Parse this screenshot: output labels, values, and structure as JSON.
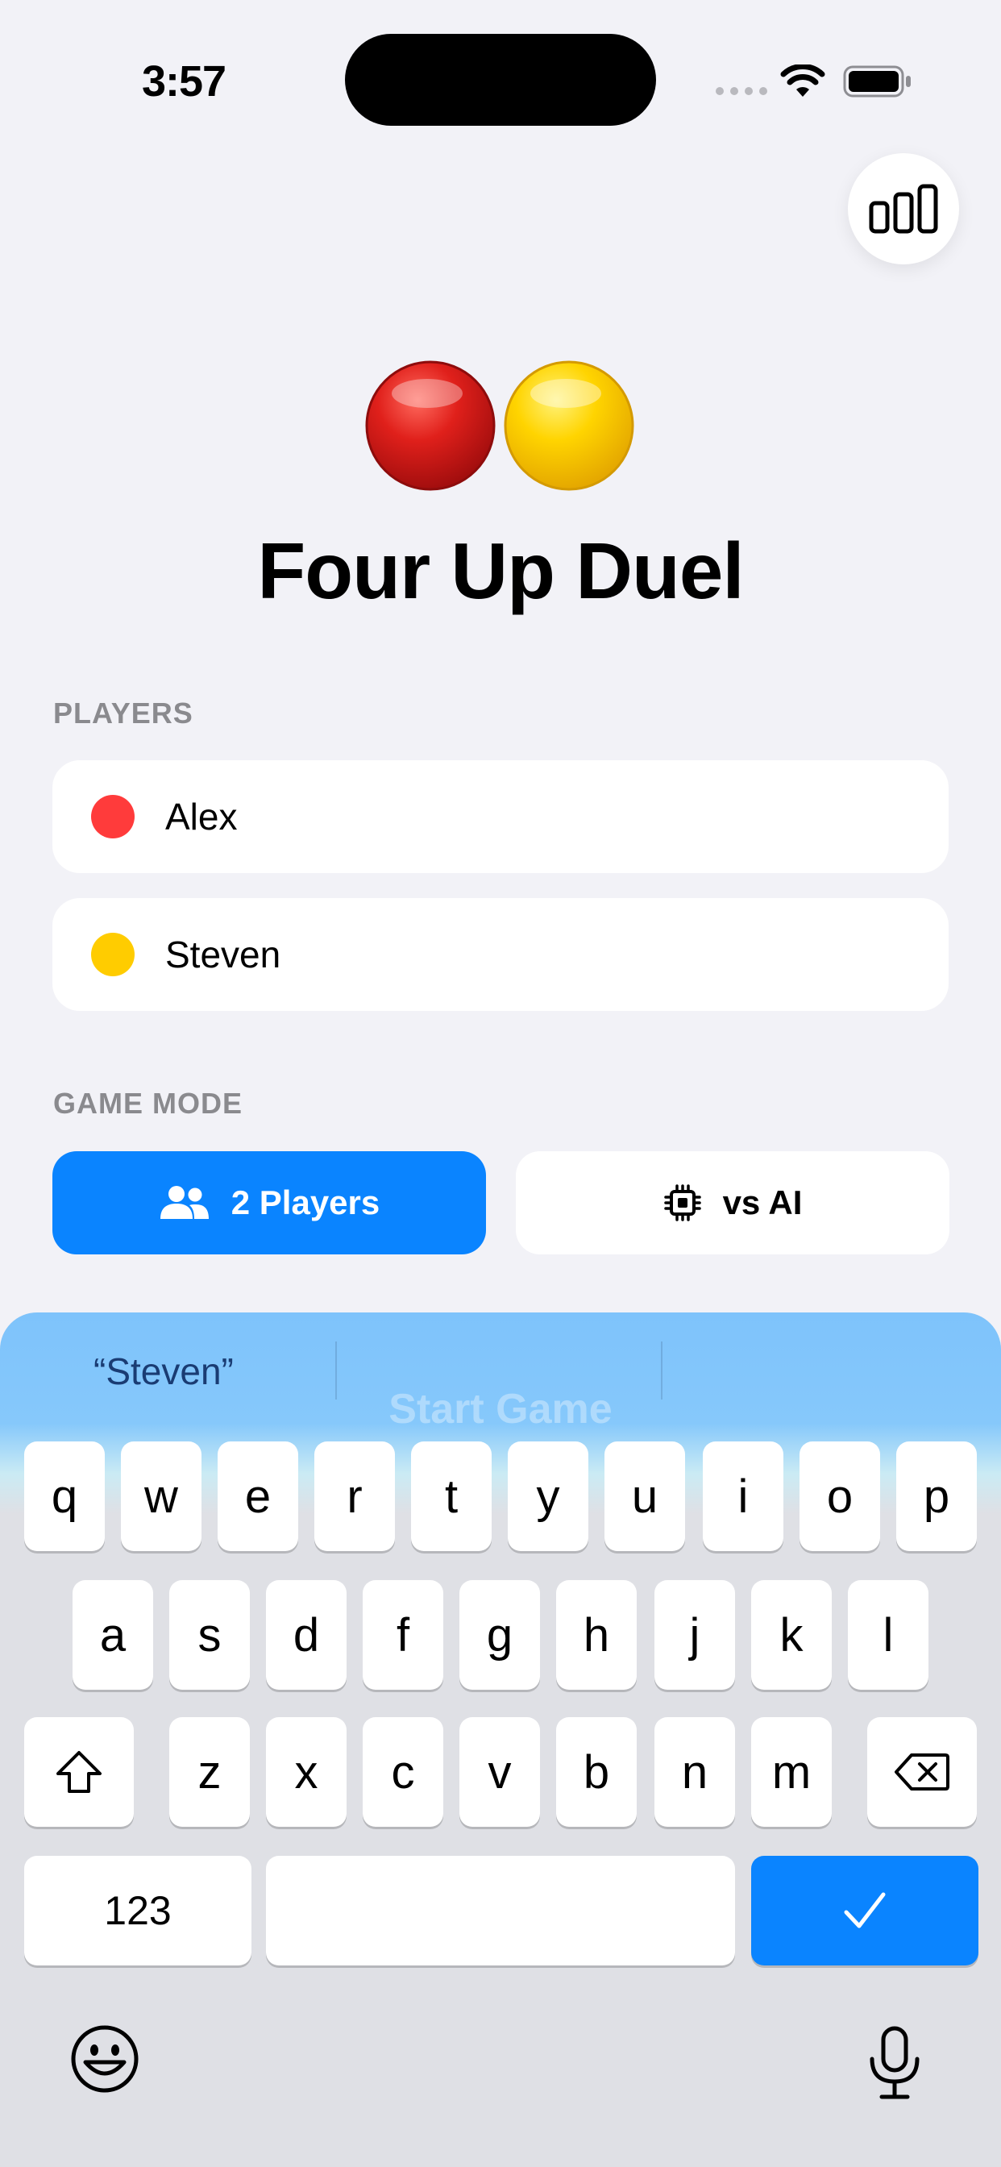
{
  "status_bar": {
    "time": "3:57"
  },
  "app": {
    "title": "Four Up Duel"
  },
  "players": {
    "label": "PLAYERS",
    "list": [
      {
        "name": "Alex",
        "color": "#FF3B3B"
      },
      {
        "name": "Steven",
        "color": "#FFCC00"
      }
    ]
  },
  "game_mode": {
    "label": "GAME MODE",
    "options": [
      {
        "label": "2 Players",
        "icon": "two-people-icon",
        "selected": true
      },
      {
        "label": "vs AI",
        "icon": "cpu-chip-icon",
        "selected": false
      }
    ],
    "accent_color": "#0A84FF"
  },
  "keyboard": {
    "suggestion": "“Steven”",
    "behind_text": "Start Game",
    "rows": [
      [
        "q",
        "w",
        "e",
        "r",
        "t",
        "y",
        "u",
        "i",
        "o",
        "p"
      ],
      [
        "a",
        "s",
        "d",
        "f",
        "g",
        "h",
        "j",
        "k",
        "l"
      ],
      [
        "z",
        "x",
        "c",
        "v",
        "b",
        "n",
        "m"
      ]
    ],
    "numbers_key": "123",
    "done_icon": "checkmark-icon",
    "shift_icon": "shift-icon",
    "delete_icon": "delete-backspace-icon",
    "emoji_icon": "emoji-face-icon",
    "mic_icon": "microphone-icon"
  }
}
